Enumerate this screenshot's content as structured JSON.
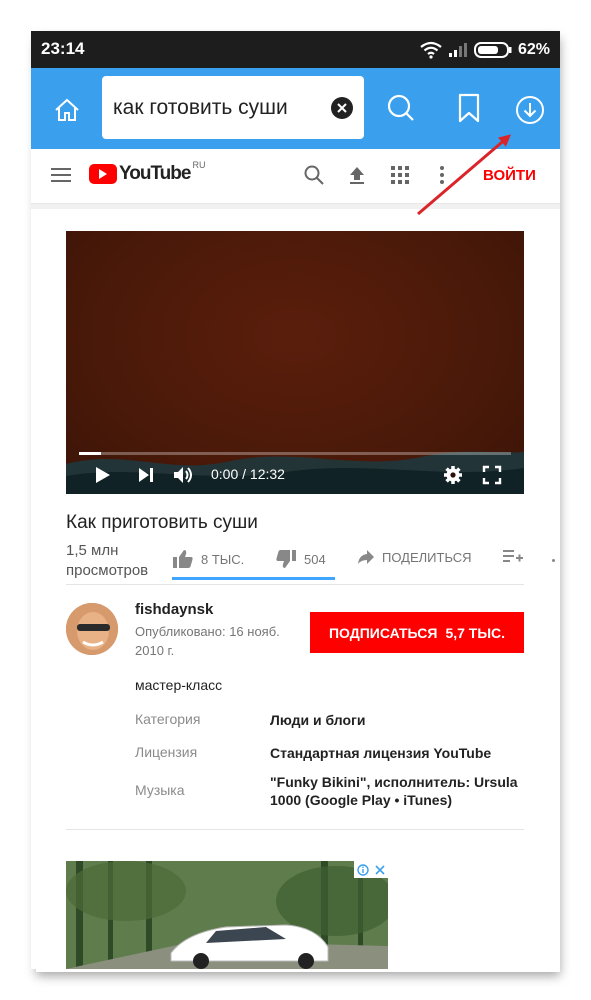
{
  "status_bar": {
    "time": "23:14",
    "battery": "62%"
  },
  "browser": {
    "search_value": "как готовить суши"
  },
  "youtube": {
    "logo_text": "YouTube",
    "region": "RU",
    "login_label": "ВОЙТИ",
    "video": {
      "time": "0:00 / 12:32",
      "progress": 0.05
    },
    "title": "Как приготовить суши",
    "views": "1,5 млн просмотров",
    "likes": "8 ТЫС.",
    "dislikes": "504",
    "share_label": "ПОДЕЛИТЬСЯ",
    "channel": {
      "name": "fishdaynsk",
      "published": "Опубликовано: 16 нояб. 2010 г.",
      "subscribe_label": "ПОДПИСАТЬСЯ",
      "subscriber_count": "5,7 ТЫС."
    },
    "description": "мастер-класс",
    "meta": [
      {
        "label": "Категория",
        "value": "Люди и блоги"
      },
      {
        "label": "Лицензия",
        "value": "Стандартная лицензия YouTube"
      },
      {
        "label": "Музыка",
        "value": "\"Funky Bikini\", исполнитель: Ursula 1000 (Google Play • iTunes)"
      }
    ]
  },
  "colors": {
    "toolbar": "#3aa0ee",
    "youtube_red": "#ff0000",
    "annotation_arrow": "#d9252a"
  }
}
